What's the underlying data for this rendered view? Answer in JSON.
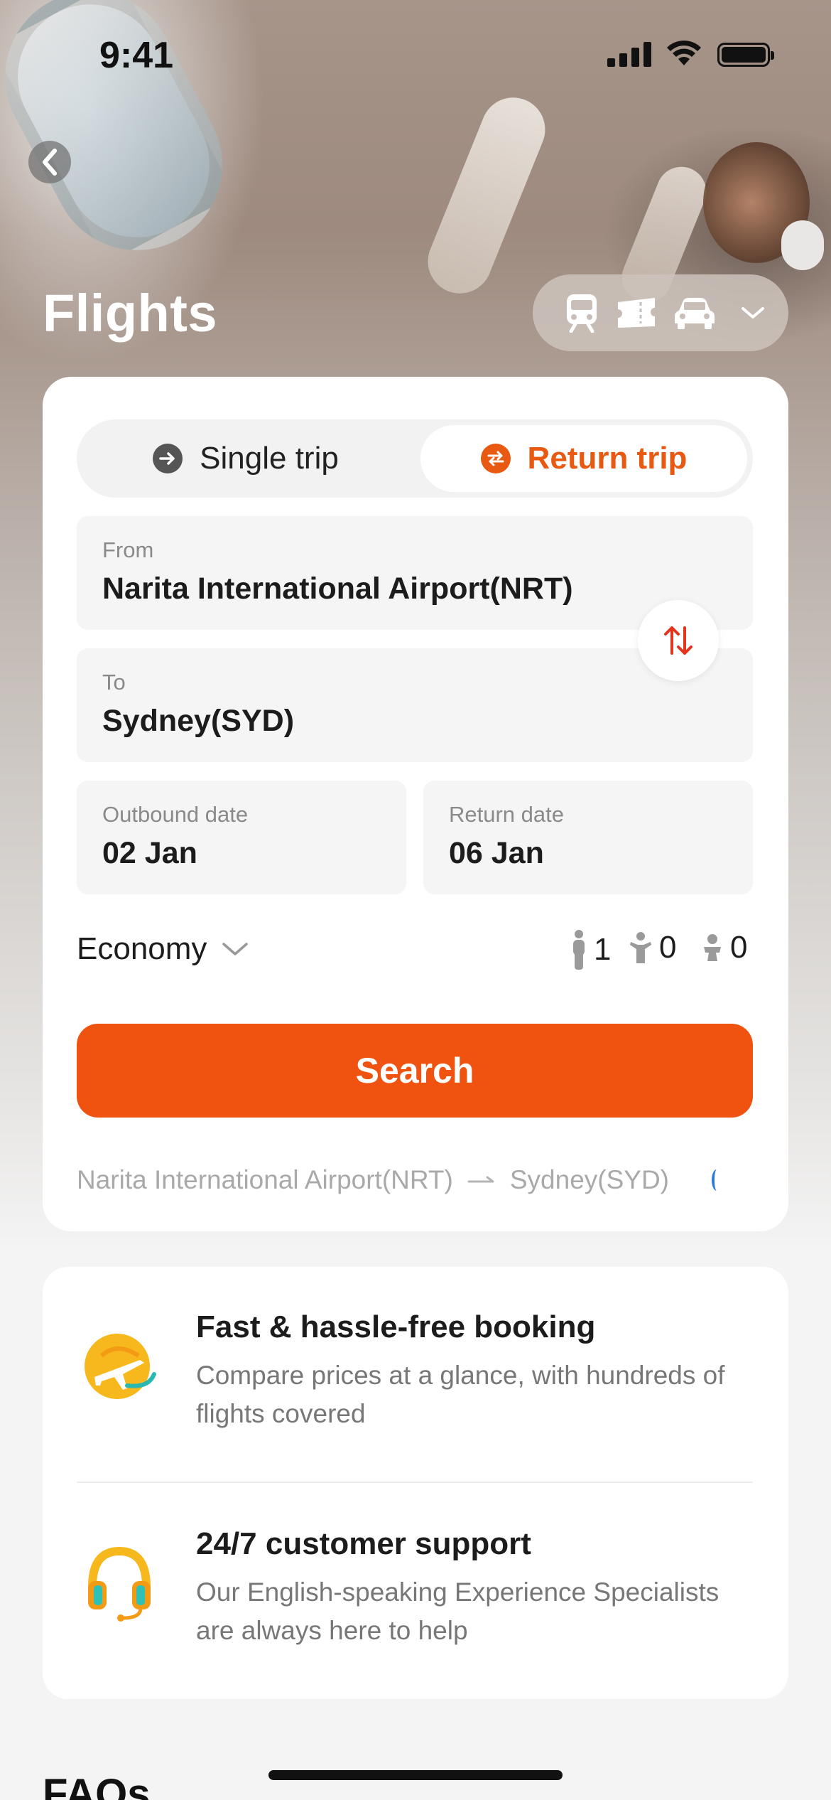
{
  "status_bar": {
    "time": "9:41"
  },
  "header": {
    "title": "Flights"
  },
  "transport_switch": {
    "icons": [
      "train-icon",
      "ticket-icon",
      "car-icon",
      "chevron-down-icon"
    ]
  },
  "trip_type": {
    "options": [
      {
        "label": "Single trip",
        "selected": false
      },
      {
        "label": "Return trip",
        "selected": true
      }
    ]
  },
  "search_form": {
    "from": {
      "label": "From",
      "value": "Narita International Airport(NRT)"
    },
    "to": {
      "label": "To",
      "value": "Sydney(SYD)"
    },
    "outbound": {
      "label": "Outbound date",
      "value": "02 Jan"
    },
    "return": {
      "label": "Return date",
      "value": "06 Jan"
    },
    "cabin_class": "Economy",
    "passengers": {
      "adults": "1",
      "children": "0",
      "infants": "0"
    },
    "search_label": "Search"
  },
  "recent_search": {
    "from": "Narita International Airport(NRT)",
    "to": "Sydney(SYD)"
  },
  "features": [
    {
      "title": "Fast & hassle-free booking",
      "description": "Compare prices at a glance, with hundreds of flights covered",
      "icon": "plane-globe-icon"
    },
    {
      "title": "24/7 customer support",
      "description": "Our English-speaking Experience Specialists are always here to help",
      "icon": "headset-icon"
    }
  ],
  "faqs": {
    "heading": "FAQs"
  },
  "colors": {
    "accent": "#ef530f",
    "accent_text": "#e85a12",
    "card": "#ffffff",
    "field_bg": "#f5f5f5"
  }
}
